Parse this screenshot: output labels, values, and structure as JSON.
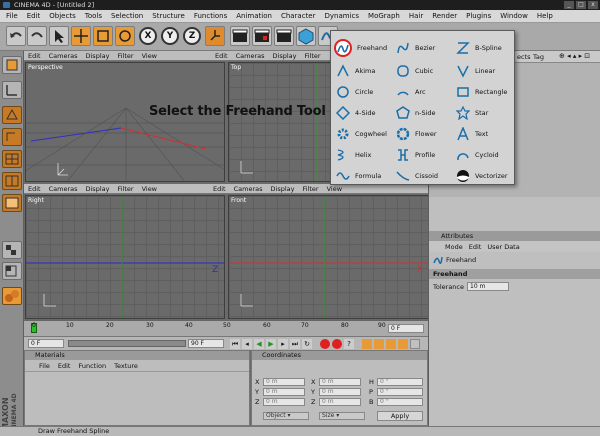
{
  "window": {
    "title": "CINEMA 4D - [Untitled 2]",
    "buttons": [
      "_",
      "□",
      "x"
    ]
  },
  "menu": [
    "File",
    "Edit",
    "Objects",
    "Tools",
    "Selection",
    "Structure",
    "Functions",
    "Animation",
    "Character",
    "Dynamics",
    "MoGraph",
    "Hair",
    "Render",
    "Plugins",
    "Window",
    "Help"
  ],
  "toolbar": {
    "axis_x": "X",
    "axis_y": "Y",
    "axis_z": "Z"
  },
  "viewport_menu": [
    "Edit",
    "Cameras",
    "Display",
    "Filter",
    "View"
  ],
  "viewports": {
    "perspective": "Perspective",
    "top": "Top",
    "right": "Right",
    "front": "Front"
  },
  "overlay_caption": "Select the Freehand Tool",
  "spline_menu": [
    [
      "Freehand",
      "Bezier",
      "B-Spline"
    ],
    [
      "Akima",
      "Cubic",
      "Linear"
    ],
    [
      "Circle",
      "Arc",
      "Rectangle"
    ],
    [
      "4-Side",
      "n-Side",
      "Star"
    ],
    [
      "Cogwheel",
      "Flower",
      "Text"
    ],
    [
      "Helix",
      "Profile",
      "Cycloid"
    ],
    [
      "Formula",
      "Cissoid",
      "Vectorizer"
    ]
  ],
  "objects_panel": {
    "menu_left": "ects",
    "tabs_label": "Tag"
  },
  "attributes": {
    "header": "Attributes",
    "tabs": [
      "Mode",
      "Edit",
      "User Data"
    ],
    "tool_name": "Freehand",
    "section": "Freehand",
    "tolerance_label": "Tolerance",
    "tolerance_value": "10 m"
  },
  "timeline": {
    "ticks": [
      "0",
      "10",
      "20",
      "30",
      "40",
      "50",
      "60",
      "70",
      "80",
      "90"
    ],
    "frame_right": "0 F"
  },
  "transport": {
    "start": "0 F",
    "end": "90 F"
  },
  "materials": {
    "header": "Materials",
    "menu": [
      "File",
      "Edit",
      "Function",
      "Texture"
    ]
  },
  "coordinates": {
    "header": "Coordinates",
    "rows": [
      {
        "a": "X",
        "av": "0 m",
        "b": "X",
        "bv": "0 m",
        "c": "H",
        "cv": "0 °"
      },
      {
        "a": "Y",
        "av": "0 m",
        "b": "Y",
        "bv": "0 m",
        "c": "P",
        "cv": "0 °"
      },
      {
        "a": "Z",
        "av": "0 m",
        "b": "Z",
        "bv": "0 m",
        "c": "B",
        "cv": "0 °"
      }
    ],
    "mode1": "Object",
    "mode2": "Size",
    "apply": "Apply"
  },
  "logo": {
    "line1": "MAXON",
    "line2": "CINEMA 4D"
  },
  "status": "Draw Freehand Spline",
  "colors": {
    "menu_bg": "#d8d8d8",
    "accent_orange": "#e79a35",
    "highlight_red": "#e02020",
    "axis_blue": "#2a2ad0",
    "axis_green": "#2aa02a"
  }
}
